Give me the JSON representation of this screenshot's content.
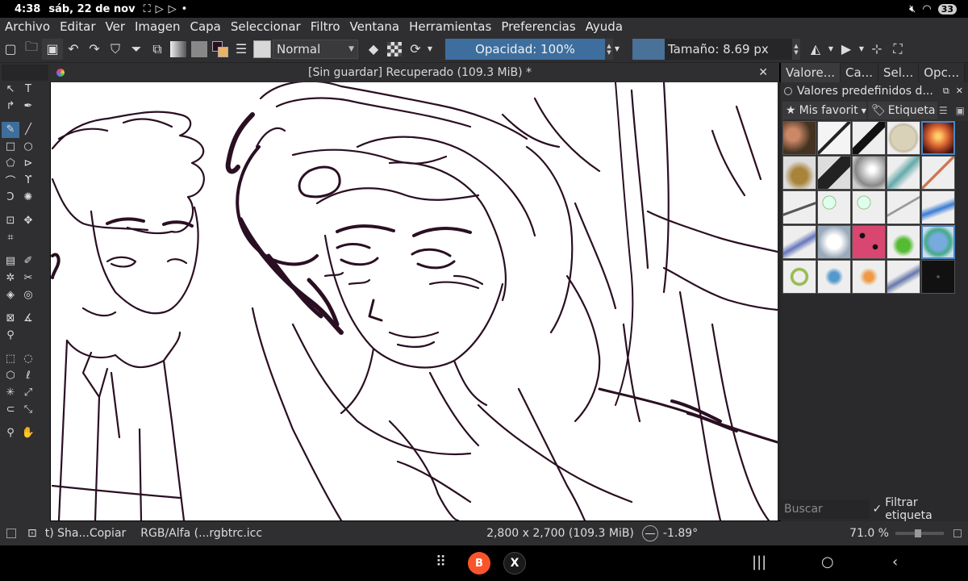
{
  "status_bar": {
    "time": "4:38",
    "date": "sáb, 22 de nov",
    "battery": "33"
  },
  "menu": [
    "Archivo",
    "Editar",
    "Ver",
    "Imagen",
    "Capa",
    "Seleccionar",
    "Filtro",
    "Ventana",
    "Herramientas",
    "Preferencias",
    "Ayuda"
  ],
  "toolbar": {
    "blend_mode": "Normal",
    "opacity_label": "Opacidad: 100%",
    "size_label": "Tamaño: 8.69 px"
  },
  "document_tab": {
    "title": "[Sin guardar]  Recuperado (109.3 MiB) *"
  },
  "docker": {
    "tabs": [
      "Valore...",
      "Ca...",
      "Sel...",
      "Opc..."
    ],
    "title": "Valores predefinidos d...",
    "favorites_label": "Mis favorit",
    "tag_label": "Etiqueta",
    "search_placeholder": "Buscar",
    "filter_tag_label": "Filtrar etiqueta",
    "presets": [
      "photo-cats",
      "ink-pen",
      "ink-brush",
      "texture-paper",
      "photo-fire",
      "blender-cone",
      "eraser-block",
      "smudge-soft",
      "airbrush",
      "ink-fine",
      "ink-dry",
      "text-t",
      "text-s",
      "pencil-lines",
      "watercolor-blue",
      "paint-wet",
      "blur-white",
      "pattern-stars",
      "chem-flask",
      "creature-blue",
      "stamp-ring",
      "stamp-flower",
      "stamp-orange",
      "spray-dots",
      "sparkle-dark"
    ]
  },
  "app_status": {
    "brush_name": "t) Sha...Copiar",
    "color_profile": "RGB/Alfa (...rgbtrc.icc",
    "dimensions": "2,800 x 2,700 (109.3 MiB)",
    "rotation": "-1.89°",
    "zoom": "71.0 %"
  },
  "colors": {
    "accent": "#3d6e9e",
    "panel": "#2f2f31",
    "ink": "#2a0f22"
  }
}
